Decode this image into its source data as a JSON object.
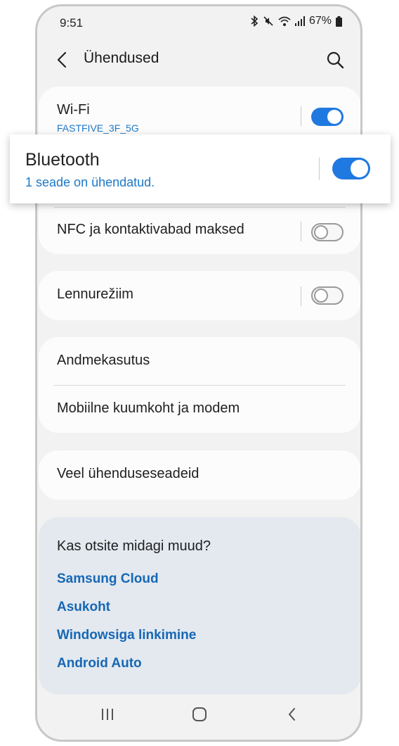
{
  "status_bar": {
    "time": "9:51",
    "battery": "67%",
    "icons": [
      "bluetooth-icon",
      "mute-icon",
      "wifi-icon",
      "signal-icon",
      "battery-icon"
    ]
  },
  "header": {
    "title": "Ühendused",
    "back_icon": "chevron-left-icon",
    "search_icon": "search-icon"
  },
  "settings": {
    "wifi": {
      "label": "Wi-Fi",
      "sub": "FASTFIVE_3F_5G",
      "enabled": true
    },
    "bluetooth": {
      "label": "Bluetooth",
      "sub": "1 seade on ühendatud.",
      "enabled": true
    },
    "nfc": {
      "label": "NFC ja kontaktivabad maksed",
      "enabled": false
    },
    "airplane": {
      "label": "Lennurežiim",
      "enabled": false
    },
    "data_usage": {
      "label": "Andmekasutus"
    },
    "hotspot": {
      "label": "Mobiilne kuumkoht ja modem"
    },
    "more": {
      "label": "Veel ühenduseseadeid"
    }
  },
  "suggestions": {
    "title": "Kas otsite midagi muud?",
    "links": [
      "Samsung Cloud",
      "Asukoht",
      "Windowsiga linkimine",
      "Android Auto"
    ]
  },
  "nav_bar": {
    "icons": [
      "recent-apps-icon",
      "home-icon",
      "back-icon"
    ]
  },
  "colors": {
    "accent": "#1f79e0",
    "link": "#1767b5",
    "background": "#f2f2f2",
    "suggest_bg": "#e3e9ef"
  }
}
